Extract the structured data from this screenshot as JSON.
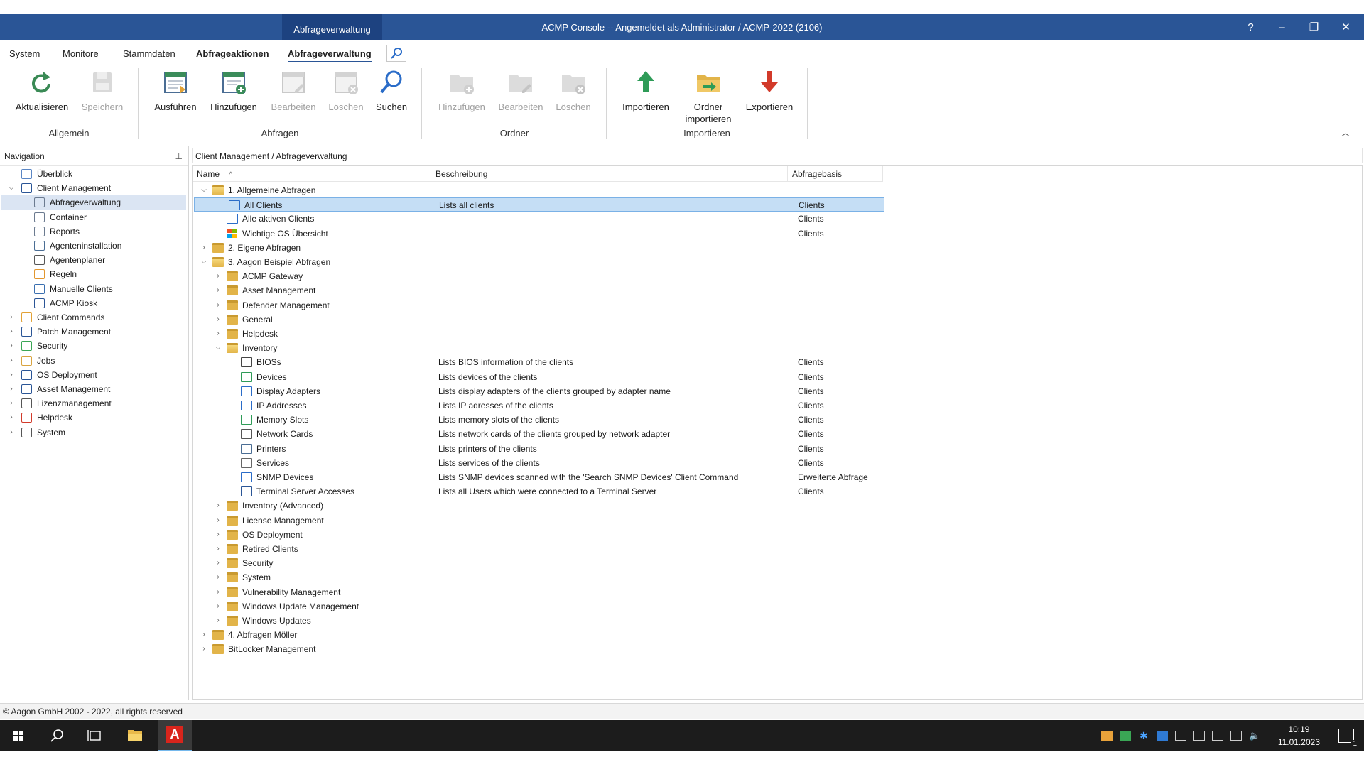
{
  "window": {
    "context_tab": "Abfrageverwaltung",
    "title": "ACMP Console -- Angemeldet als Administrator / ACMP-2022 (2106)",
    "buttons": {
      "help": "?",
      "minimize": "–",
      "restore": "❐",
      "close": "✕"
    }
  },
  "menu_tabs": [
    "System",
    "Monitore",
    "Stammdaten",
    "Abfrageaktionen",
    "Abfrageverwaltung"
  ],
  "ribbon": {
    "groups": {
      "allgemein": "Allgemein",
      "abfragen": "Abfragen",
      "ordner": "Ordner",
      "importieren": "Importieren"
    },
    "buttons": {
      "aktualisieren": "Aktualisieren",
      "speichern": "Speichern",
      "ausfuehren": "Ausführen",
      "hinzufuegen": "Hinzufügen",
      "bearbeiten": "Bearbeiten",
      "loeschen": "Löschen",
      "suchen": "Suchen",
      "ordner_hinzufuegen": "Hinzufügen",
      "ordner_bearbeiten": "Bearbeiten",
      "ordner_loeschen": "Löschen",
      "importieren": "Importieren",
      "ordner_importieren_1": "Ordner",
      "ordner_importieren_2": "importieren",
      "exportieren": "Exportieren"
    },
    "colors": {
      "refresh": "#3a8a55",
      "import": "#2e9b57",
      "export": "#d23a2a",
      "search": "#2a6cc8"
    }
  },
  "navigation": {
    "header": "Navigation",
    "items": [
      {
        "label": "Überblick",
        "icon": "overview-icon"
      },
      {
        "label": "Client Management",
        "icon": "monitor-icon"
      },
      {
        "label": "Abfrageverwaltung",
        "icon": "query-icon"
      },
      {
        "label": "Container",
        "icon": "container-icon"
      },
      {
        "label": "Reports",
        "icon": "report-icon"
      },
      {
        "label": "Agenteninstallation",
        "icon": "agent-install-icon"
      },
      {
        "label": "Agentenplaner",
        "icon": "clock-icon"
      },
      {
        "label": "Regeln",
        "icon": "rules-icon"
      },
      {
        "label": "Manuelle Clients",
        "icon": "cube-icon"
      },
      {
        "label": "ACMP Kiosk",
        "icon": "kiosk-icon"
      },
      {
        "label": "Client Commands",
        "icon": "puzzle-icon"
      },
      {
        "label": "Patch Management",
        "icon": "patch-icon"
      },
      {
        "label": "Security",
        "icon": "shield-icon"
      },
      {
        "label": "Jobs",
        "icon": "jobs-icon"
      },
      {
        "label": "OS Deployment",
        "icon": "os-deploy-icon"
      },
      {
        "label": "Asset Management",
        "icon": "asset-icon"
      },
      {
        "label": "Lizenzmanagement",
        "icon": "license-icon"
      },
      {
        "label": "Helpdesk",
        "icon": "helpdesk-icon"
      },
      {
        "label": "System",
        "icon": "system-icon"
      }
    ]
  },
  "breadcrumb": "Client Management / Abfrageverwaltung",
  "grid": {
    "columns": [
      "Name",
      "Beschreibung",
      "Abfragebasis"
    ],
    "rows": [
      {
        "name": "1. Allgemeine Abfragen",
        "desc": "",
        "base": ""
      },
      {
        "name": "All Clients",
        "desc": "Lists all clients",
        "base": "Clients"
      },
      {
        "name": "Alle aktiven Clients",
        "desc": "",
        "base": "Clients"
      },
      {
        "name": "Wichtige OS Übersicht",
        "desc": "",
        "base": "Clients"
      },
      {
        "name": "2. Eigene Abfragen",
        "desc": "",
        "base": ""
      },
      {
        "name": "3. Aagon Beispiel Abfragen",
        "desc": "",
        "base": ""
      },
      {
        "name": "ACMP Gateway",
        "desc": "",
        "base": ""
      },
      {
        "name": "Asset Management",
        "desc": "",
        "base": ""
      },
      {
        "name": "Defender Management",
        "desc": "",
        "base": ""
      },
      {
        "name": "General",
        "desc": "",
        "base": ""
      },
      {
        "name": "Helpdesk",
        "desc": "",
        "base": ""
      },
      {
        "name": "Inventory",
        "desc": "",
        "base": ""
      },
      {
        "name": "BIOSs",
        "desc": "Lists BIOS information of the clients",
        "base": "Clients"
      },
      {
        "name": "Devices",
        "desc": "Lists devices of the clients",
        "base": "Clients"
      },
      {
        "name": "Display Adapters",
        "desc": "Lists display adapters of the clients grouped by adapter name",
        "base": "Clients"
      },
      {
        "name": "IP Addresses",
        "desc": "Lists IP adresses of the clients",
        "base": "Clients"
      },
      {
        "name": "Memory Slots",
        "desc": "Lists memory slots of the clients",
        "base": "Clients"
      },
      {
        "name": "Network Cards",
        "desc": "Lists network cards of the clients grouped by network adapter",
        "base": "Clients"
      },
      {
        "name": "Printers",
        "desc": "Lists printers of the clients",
        "base": "Clients"
      },
      {
        "name": "Services",
        "desc": "Lists services of the clients",
        "base": "Clients"
      },
      {
        "name": "SNMP Devices",
        "desc": "Lists SNMP devices scanned with the 'Search SNMP Devices' Client Command",
        "base": "Erweiterte Abfrage"
      },
      {
        "name": "Terminal Server Accesses",
        "desc": "Lists all Users which were connected to a Terminal Server",
        "base": "Clients"
      },
      {
        "name": "Inventory (Advanced)",
        "desc": "",
        "base": ""
      },
      {
        "name": "License Management",
        "desc": "",
        "base": ""
      },
      {
        "name": "OS Deployment",
        "desc": "",
        "base": ""
      },
      {
        "name": "Retired Clients",
        "desc": "",
        "base": ""
      },
      {
        "name": "Security",
        "desc": "",
        "base": ""
      },
      {
        "name": "System",
        "desc": "",
        "base": ""
      },
      {
        "name": "Vulnerability Management",
        "desc": "",
        "base": ""
      },
      {
        "name": "Windows Update Management",
        "desc": "",
        "base": ""
      },
      {
        "name": "Windows Updates",
        "desc": "",
        "base": ""
      },
      {
        "name": "4. Abfragen Möller",
        "desc": "",
        "base": ""
      },
      {
        "name": "BitLocker Management",
        "desc": "",
        "base": ""
      }
    ]
  },
  "status_bar": "© Aagon GmbH 2002 - 2022, all rights reserved",
  "taskbar": {
    "time": "10:19",
    "date": "11.01.2023",
    "notifications": "1",
    "app_letter": "A"
  }
}
